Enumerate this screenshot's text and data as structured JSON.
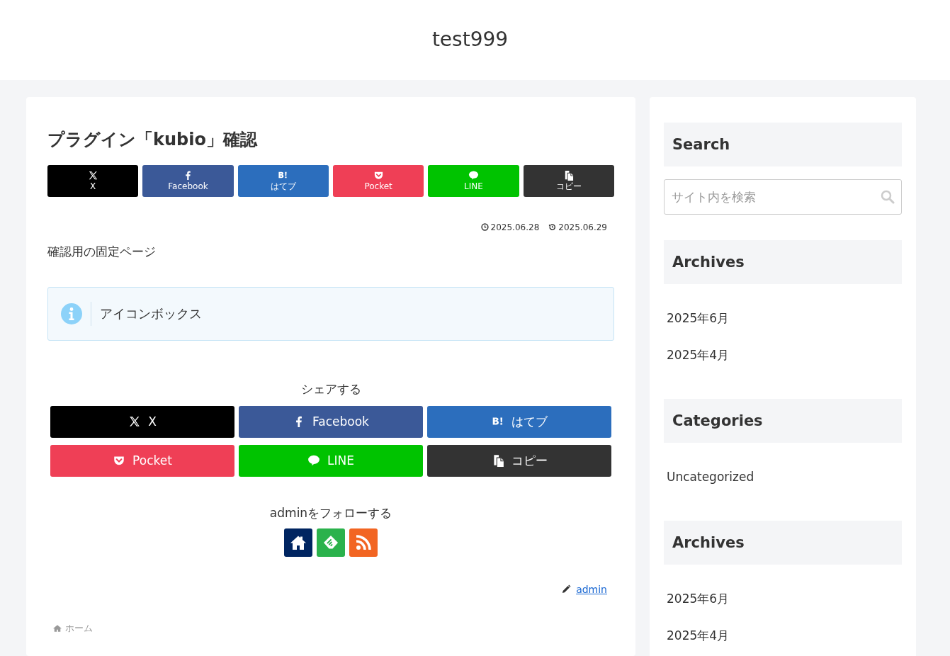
{
  "site_title": "test999",
  "article": {
    "title": "プラグイン「kubio」確認",
    "top_share": [
      {
        "kind": "x",
        "label": "X"
      },
      {
        "kind": "facebook",
        "label": "Facebook"
      },
      {
        "kind": "hatena",
        "label": "はてブ"
      },
      {
        "kind": "pocket",
        "label": "Pocket"
      },
      {
        "kind": "line",
        "label": "LINE"
      },
      {
        "kind": "copy",
        "label": "コピー"
      }
    ],
    "posted": "2025.06.28",
    "updated": "2025.06.29",
    "body": "確認用の固定ページ",
    "info_box": "アイコンボックス",
    "share_heading": "シェアする",
    "bottom_share": [
      {
        "kind": "x",
        "label": "X"
      },
      {
        "kind": "facebook",
        "label": "Facebook"
      },
      {
        "kind": "hatena",
        "label": "はてブ"
      },
      {
        "kind": "pocket",
        "label": "Pocket"
      },
      {
        "kind": "line",
        "label": "LINE"
      },
      {
        "kind": "copy",
        "label": "コピー"
      }
    ],
    "follow_heading": "adminをフォローする",
    "follow_buttons": [
      {
        "kind": "home"
      },
      {
        "kind": "feedly"
      },
      {
        "kind": "rss"
      }
    ],
    "author": "admin",
    "breadcrumb": "ホーム"
  },
  "sidebar": [
    {
      "kind": "search",
      "title": "Search",
      "placeholder": "サイト内を検索"
    },
    {
      "kind": "list",
      "title": "Archives",
      "items": [
        "2025年6月",
        "2025年4月"
      ]
    },
    {
      "kind": "list",
      "title": "Categories",
      "items": [
        "Uncategorized"
      ]
    },
    {
      "kind": "list",
      "title": "Archives",
      "items": [
        "2025年6月",
        "2025年4月"
      ]
    }
  ]
}
